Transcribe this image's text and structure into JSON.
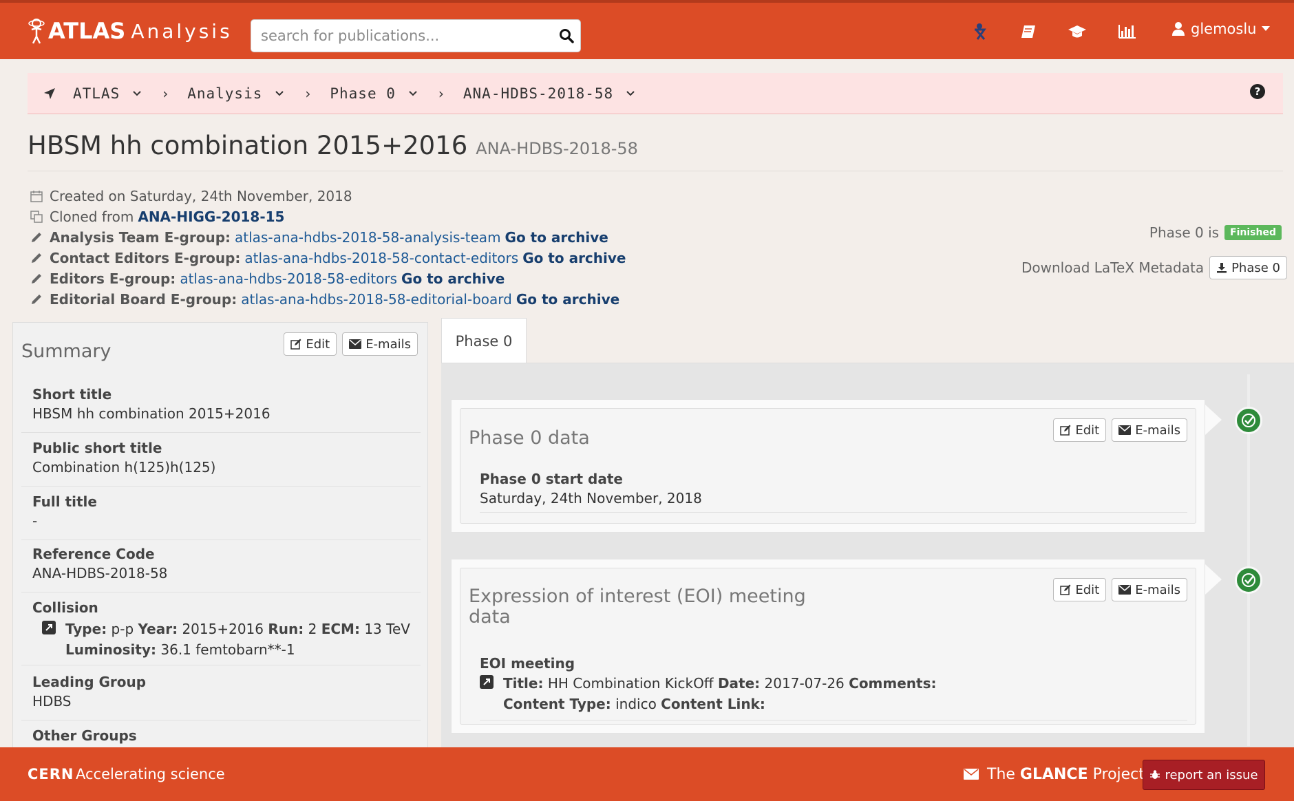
{
  "header": {
    "logo_main": "ATLAS",
    "logo_sub": "Analysis",
    "search_placeholder": "search for publications...",
    "user": "glemoslu",
    "nav_icons": [
      "cern-people-icon",
      "book-icon",
      "graduation-cap-icon",
      "bar-chart-icon"
    ]
  },
  "breadcrumb": [
    "ATLAS",
    "Analysis",
    "Phase 0",
    "ANA-HDBS-2018-58"
  ],
  "page": {
    "title": "HBSM hh combination 2015+2016",
    "code": "ANA-HDBS-2018-58",
    "created": "Created on Saturday, 24th November, 2018",
    "cloned_label": "Cloned from",
    "cloned_ref": "ANA-HIGG-2018-15",
    "egroups": [
      {
        "label": "Analysis Team E-group:",
        "value": "atlas-ana-hdbs-2018-58-analysis-team",
        "link": "Go to archive"
      },
      {
        "label": "Contact Editors E-group:",
        "value": "atlas-ana-hdbs-2018-58-contact-editors",
        "link": "Go to archive"
      },
      {
        "label": "Editors E-group:",
        "value": "atlas-ana-hdbs-2018-58-editors",
        "link": "Go to archive"
      },
      {
        "label": "Editorial Board E-group:",
        "value": "atlas-ana-hdbs-2018-58-editorial-board",
        "link": "Go to archive"
      }
    ],
    "phase_status_text": "Phase 0 is",
    "phase_status_badge": "Finished",
    "download_label": "Download LaTeX Metadata",
    "download_button": "Phase 0"
  },
  "summary": {
    "heading": "Summary",
    "edit": "Edit",
    "emails": "E-mails",
    "short_title_label": "Short title",
    "short_title": "HBSM hh combination 2015+2016",
    "public_short_title_label": "Public short title",
    "public_short_title": "Combination h(125)h(125)",
    "full_title_label": "Full title",
    "full_title": "-",
    "ref_code_label": "Reference Code",
    "ref_code": "ANA-HDBS-2018-58",
    "collision_label": "Collision",
    "collision": {
      "type_label": "Type:",
      "type": "p-p",
      "year_label": "Year:",
      "year": "2015+2016",
      "run_label": "Run:",
      "run": "2",
      "ecm_label": "ECM:",
      "ecm": "13 TeV",
      "lumi_label": "Luminosity:",
      "lumi": "36.1 femtobarn**-1"
    },
    "leading_group_label": "Leading Group",
    "leading_group": "HDBS",
    "other_groups_label": "Other Groups"
  },
  "tabs": [
    "Phase 0"
  ],
  "cards": {
    "phase0": {
      "title": "Phase 0 data",
      "edit": "Edit",
      "emails": "E-mails",
      "field_label": "Phase 0 start date",
      "field_value": "Saturday, 24th November, 2018"
    },
    "eoi": {
      "title_line1": "Expression of interest (EOI) meeting",
      "title_line2": "data",
      "edit": "Edit",
      "emails": "E-mails",
      "field_label": "EOI meeting",
      "title_label": "Title:",
      "title_value": "HH Combination KickOff",
      "date_label": "Date:",
      "date_value": "2017-07-26",
      "comments_label": "Comments:",
      "ctype_label": "Content Type:",
      "ctype_value": "indico",
      "clink_label": "Content Link:"
    }
  },
  "footer": {
    "cern": "CERN",
    "tagline": "Accelerating science",
    "glance_pre": "The",
    "glance_bold": "GLANCE",
    "glance_post": "Project",
    "report": "report an issue"
  },
  "colors": {
    "brand": "#dc4c26",
    "badge_green": "#5cb85c",
    "check_green": "#2e8b3a",
    "link": "#1e5a96",
    "report_red": "#a81f25"
  }
}
